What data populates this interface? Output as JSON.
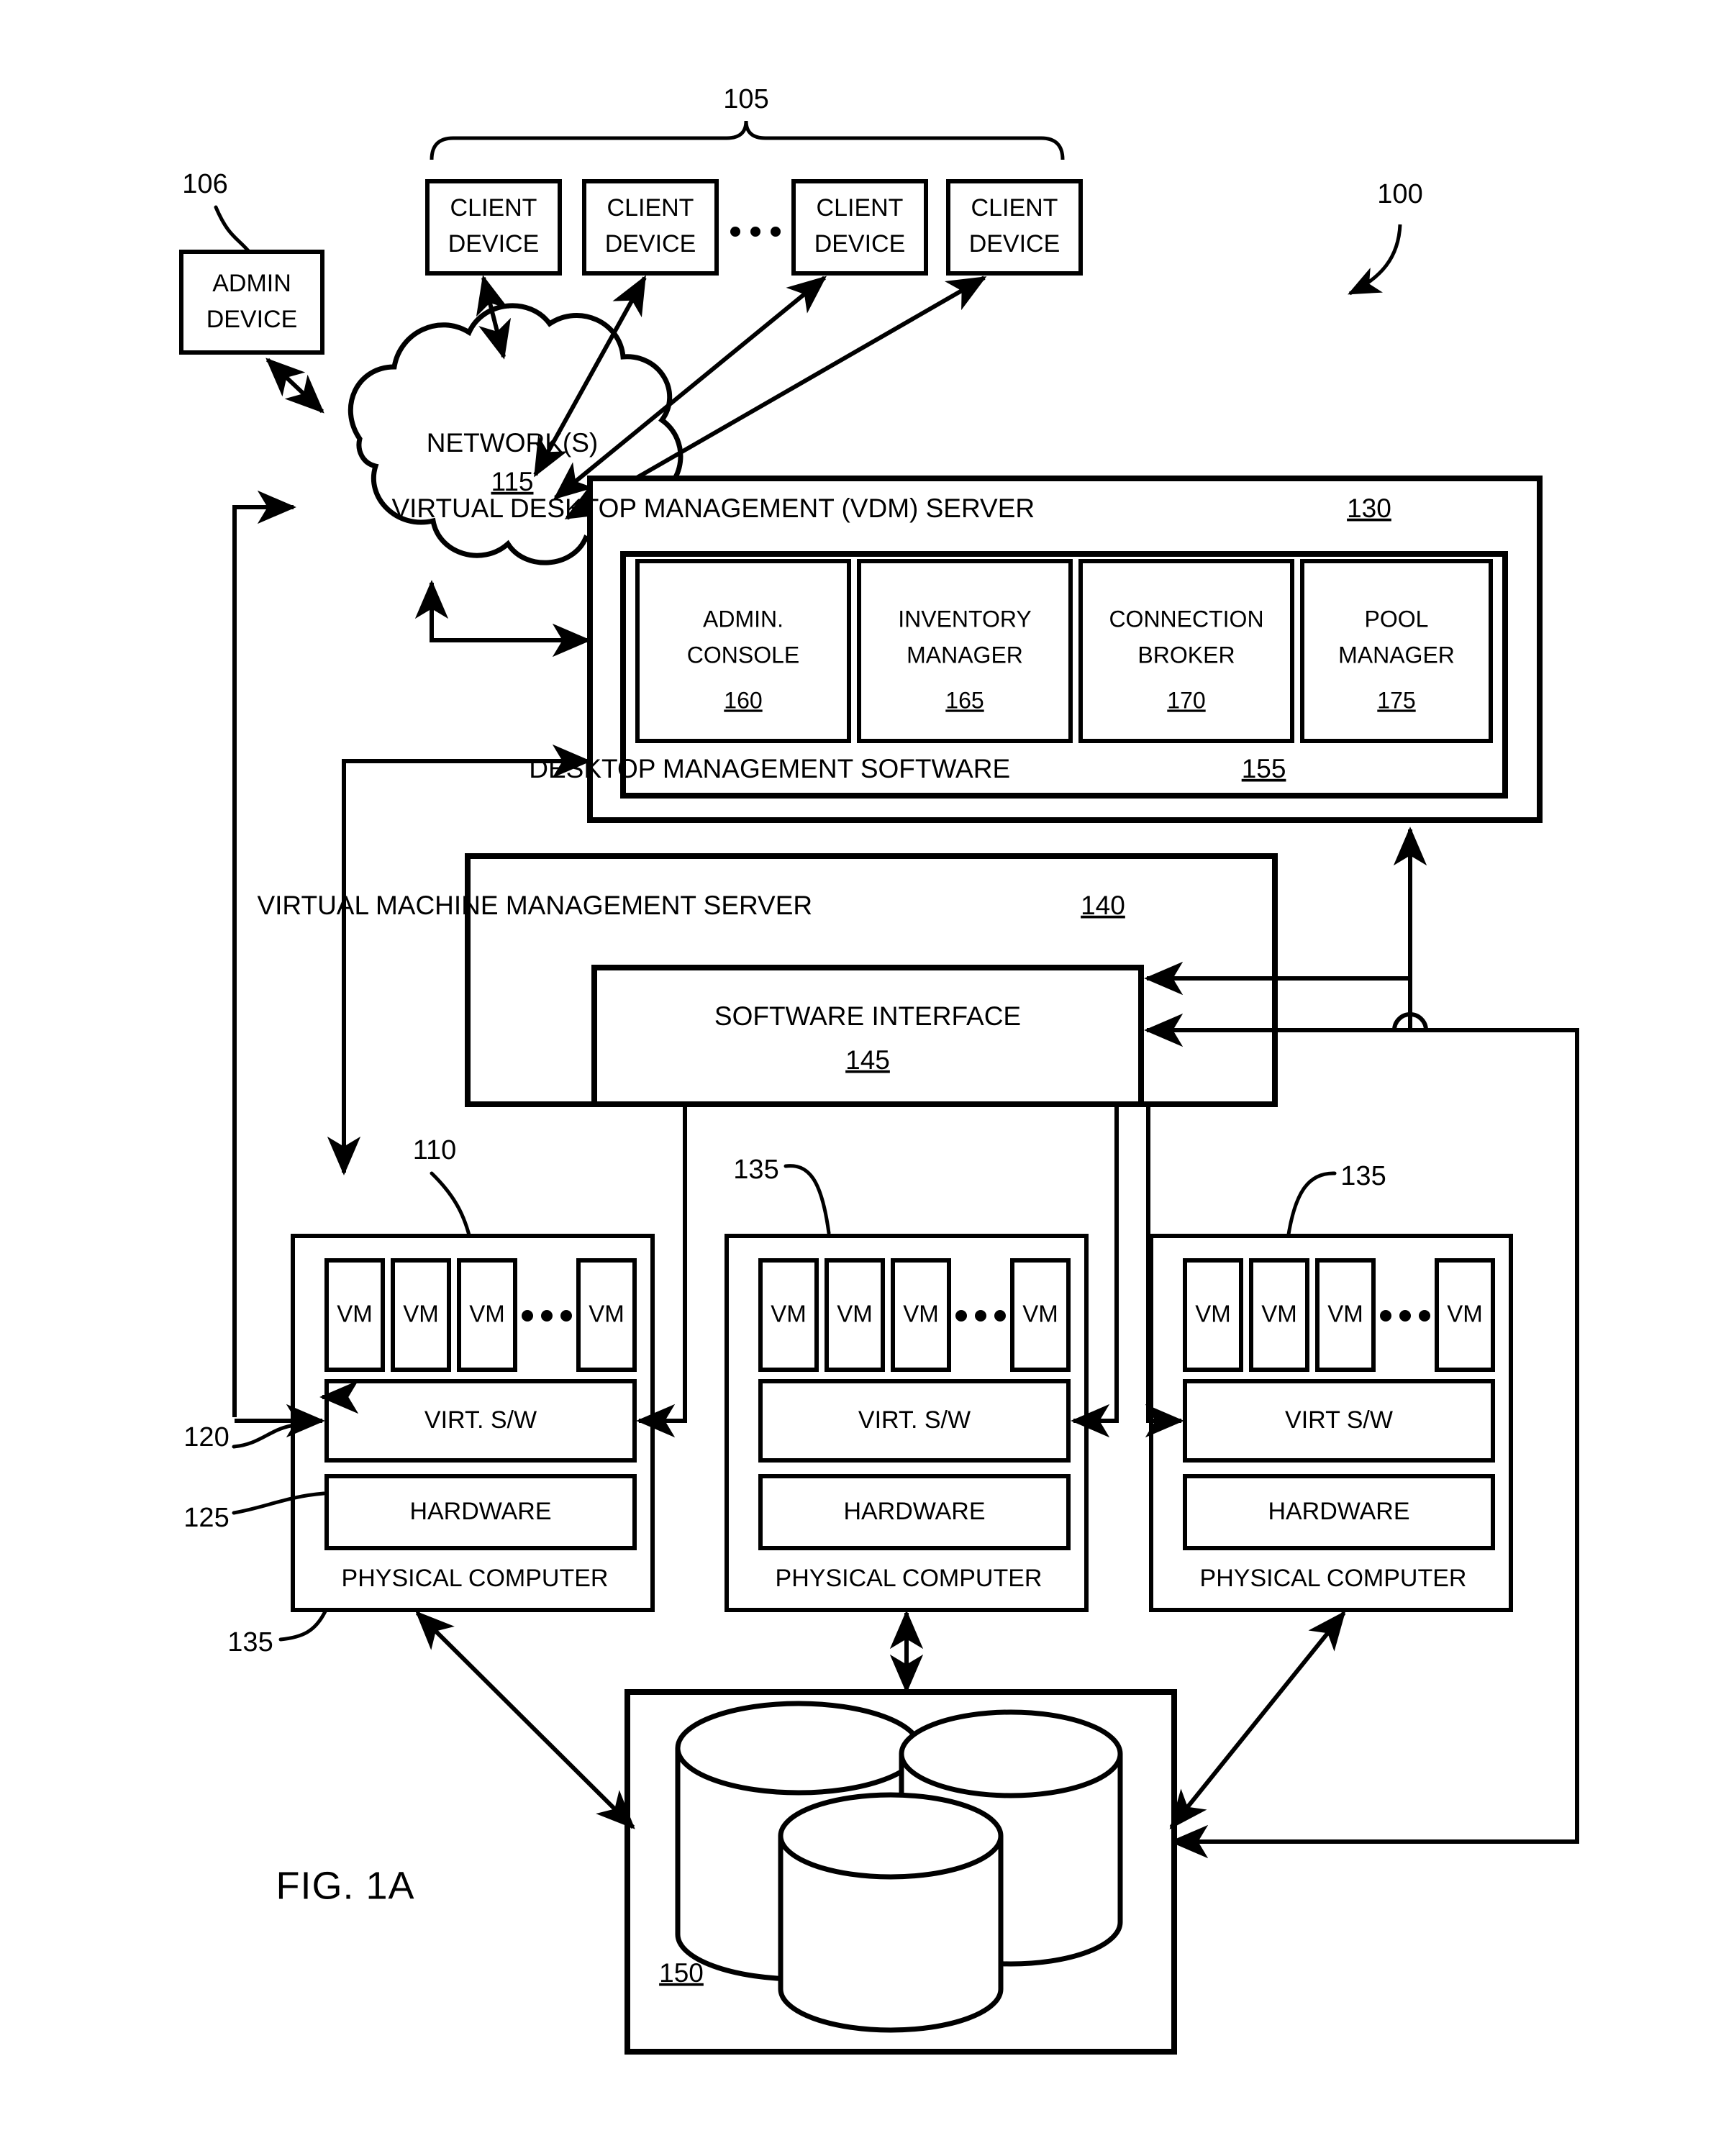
{
  "figure": {
    "label": "FIG. 1A",
    "system_ref": "100"
  },
  "admin_device": {
    "label_line1": "ADMIN",
    "label_line2": "DEVICE",
    "ref": "106"
  },
  "client_group": {
    "ref": "105",
    "ellipsis": "• • •",
    "devices": [
      {
        "line1": "CLIENT",
        "line2": "DEVICE"
      },
      {
        "line1": "CLIENT",
        "line2": "DEVICE"
      },
      {
        "line1": "CLIENT",
        "line2": "DEVICE"
      },
      {
        "line1": "CLIENT",
        "line2": "DEVICE"
      }
    ]
  },
  "network": {
    "label": "NETWORK(S)",
    "ref": "115"
  },
  "vdm_server": {
    "title": "VIRTUAL DESKTOP MANAGEMENT (VDM) SERVER",
    "ref": "130",
    "software": {
      "title": "DESKTOP MANAGEMENT SOFTWARE",
      "ref": "155"
    },
    "modules": [
      {
        "line1": "ADMIN.",
        "line2": "CONSOLE",
        "ref": "160"
      },
      {
        "line1": "INVENTORY",
        "line2": "MANAGER",
        "ref": "165"
      },
      {
        "line1": "CONNECTION",
        "line2": "BROKER",
        "ref": "170"
      },
      {
        "line1": "POOL",
        "line2": "MANAGER",
        "ref": "175"
      }
    ]
  },
  "vmm_server": {
    "title": "VIRTUAL MACHINE MANAGEMENT SERVER",
    "ref": "140",
    "software_interface": {
      "title": "SOFTWARE INTERFACE",
      "ref": "145"
    }
  },
  "physical_computers": [
    {
      "label": "PHYSICAL COMPUTER",
      "virt_sw": "VIRT. S/W",
      "hardware": "HARDWARE",
      "vm_label": "VM",
      "vm_count_shown": 4,
      "ref_top": "110",
      "ref_host": "135",
      "ref_virt_sw": "120",
      "ref_hardware": "125"
    },
    {
      "label": "PHYSICAL COMPUTER",
      "virt_sw": "VIRT. S/W",
      "hardware": "HARDWARE",
      "vm_label": "VM",
      "vm_count_shown": 4,
      "ref_host": "135"
    },
    {
      "label": "PHYSICAL COMPUTER",
      "virt_sw": "VIRT S/W",
      "hardware": "HARDWARE",
      "vm_label": "VM",
      "vm_count_shown": 4,
      "ref_host": "135"
    }
  ],
  "storage_array": {
    "ref": "150",
    "disk_count": 3
  },
  "colors": {
    "stroke": "#000000",
    "fill": "#ffffff"
  }
}
